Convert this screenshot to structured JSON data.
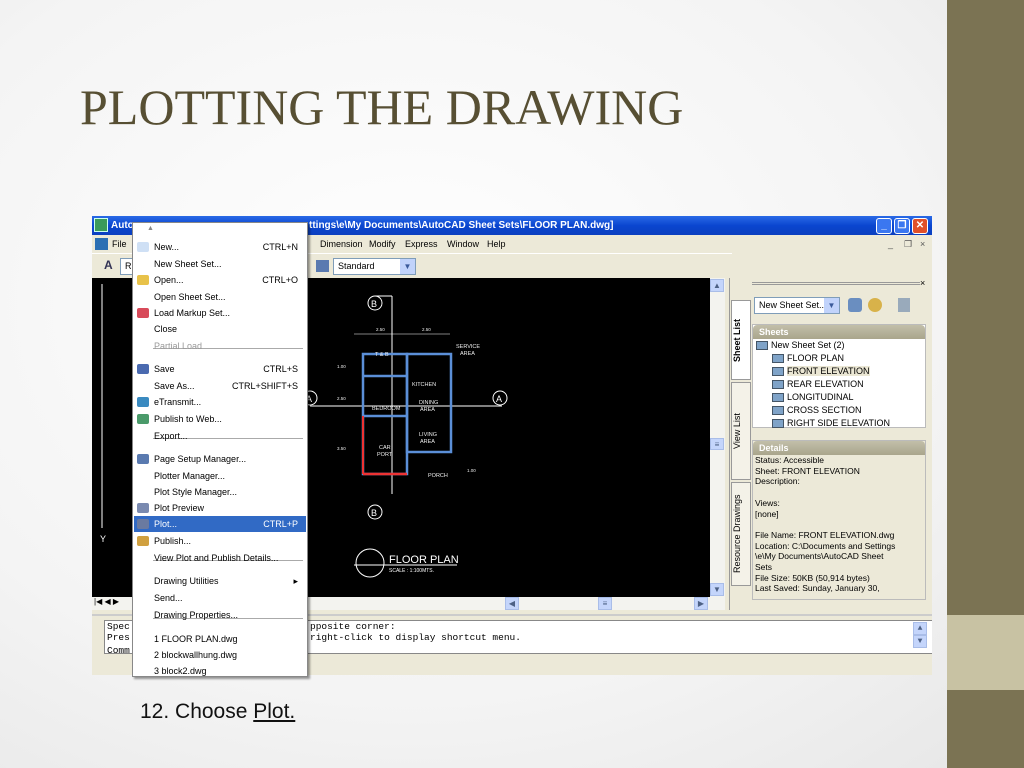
{
  "slide": {
    "title": "PLOTTING THE DRAWING",
    "caption_prefix": "12. Choose ",
    "caption_link": "Plot."
  },
  "window": {
    "title_left": "Auto",
    "title_right": "ttings\\e\\My Documents\\AutoCAD Sheet Sets\\FLOOR PLAN.dwg]",
    "min": "_",
    "max": "❐",
    "close": "✕"
  },
  "menubar": {
    "file": "File",
    "items": [
      "Dimension",
      "Modify",
      "Express",
      "Window",
      "Help"
    ],
    "doc_min": "_",
    "doc_restore": "❐",
    "doc_close": "×"
  },
  "toolbar": {
    "text_style": "R",
    "dim_style": "Standard"
  },
  "file_menu": {
    "items": [
      {
        "label": "New...",
        "shortcut": "CTRL+N"
      },
      {
        "label": "New Sheet Set...",
        "shortcut": ""
      },
      {
        "label": "Open...",
        "shortcut": "CTRL+O"
      },
      {
        "label": "Open Sheet Set...",
        "shortcut": ""
      },
      {
        "label": "Load Markup Set...",
        "shortcut": ""
      },
      {
        "label": "Close",
        "shortcut": ""
      },
      {
        "label": "Partial Load",
        "shortcut": ""
      },
      {
        "label": "Save",
        "shortcut": "CTRL+S"
      },
      {
        "label": "Save As...",
        "shortcut": "CTRL+SHIFT+S"
      },
      {
        "label": "eTransmit...",
        "shortcut": ""
      },
      {
        "label": "Publish to Web...",
        "shortcut": ""
      },
      {
        "label": "Export...",
        "shortcut": ""
      },
      {
        "label": "Page Setup Manager...",
        "shortcut": ""
      },
      {
        "label": "Plotter Manager...",
        "shortcut": ""
      },
      {
        "label": "Plot Style Manager...",
        "shortcut": ""
      },
      {
        "label": "Plot Preview",
        "shortcut": ""
      },
      {
        "label": "Plot...",
        "shortcut": "CTRL+P"
      },
      {
        "label": "Publish...",
        "shortcut": ""
      },
      {
        "label": "View Plot and Publish Details...",
        "shortcut": ""
      },
      {
        "label": "Drawing Utilities",
        "shortcut": "▸"
      },
      {
        "label": "Send...",
        "shortcut": ""
      },
      {
        "label": "Drawing Properties...",
        "shortcut": ""
      },
      {
        "label": "1 FLOOR PLAN.dwg",
        "shortcut": ""
      },
      {
        "label": "2 blockwallhung.dwg",
        "shortcut": ""
      },
      {
        "label": "3 block2.dwg",
        "shortcut": ""
      }
    ]
  },
  "drawing": {
    "dims": [
      "2.50",
      "2.50",
      "1.00",
      "2.50",
      "3.50",
      "1.00"
    ],
    "rooms": [
      "T & B",
      "SERVICE",
      "AREA",
      "KITCHEN",
      "BEDROOM",
      "DINING",
      "AREA",
      "LIVING",
      "AREA",
      "CAR",
      "PORT",
      "PORCH"
    ],
    "markers": [
      "B",
      "B",
      "A",
      "A"
    ],
    "plan_title": "FLOOR PLAN",
    "plan_scale": "SCALE  :  1:100MTS.",
    "ucs_y": "Y"
  },
  "sheet_panel": {
    "tabs": [
      "Sheet List",
      "View List",
      "Resource Drawings"
    ],
    "set_combo": "New Sheet Set...",
    "sheets_header": "Sheets",
    "root": "New Sheet Set (2)",
    "sheets": [
      "FLOOR PLAN",
      "FRONT ELEVATION",
      "REAR ELEVATION",
      "LONGITUDINAL",
      "CROSS SECTION",
      "RIGHT SIDE ELEVATION"
    ],
    "selected": "FRONT ELEVATION",
    "details_header": "Details",
    "details": [
      "Status: Accessible",
      "Sheet: FRONT ELEVATION",
      "Description:",
      "",
      "Views:",
      "[none]",
      "",
      "File Name: FRONT ELEVATION.dwg",
      "Location: C:\\Documents and Settings",
      "\\e\\My Documents\\AutoCAD Sheet",
      "Sets",
      "File Size: 50KB (50,914 bytes)",
      "Last Saved: Sunday, January 30,"
    ]
  },
  "command": {
    "lines_left": [
      "Spec",
      "Pres",
      "Comm"
    ],
    "line1": "pposite corner:",
    "line2": "right-click to display shortcut menu."
  }
}
